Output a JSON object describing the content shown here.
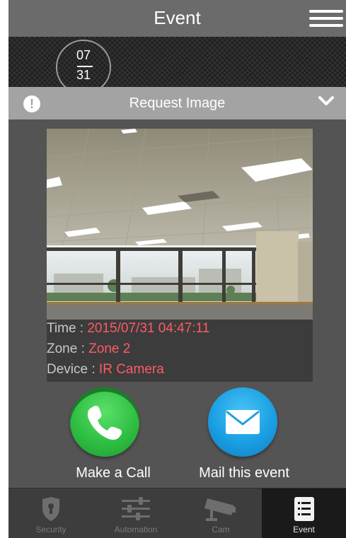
{
  "header": {
    "title": "Event"
  },
  "date_badge": {
    "month": "07",
    "day": "31"
  },
  "request_bar": {
    "label": "Request Image"
  },
  "event_info": {
    "time_label": "Time : ",
    "time_value": "2015/07/31 04:47:11",
    "zone_label": "Zone : ",
    "zone_value": "Zone 2",
    "device_label": "Device : ",
    "device_value": "IR Camera"
  },
  "actions": {
    "call_label": "Make a Call",
    "mail_label": "Mail this event"
  },
  "tabs": [
    {
      "label": "Security",
      "icon": "shield-icon",
      "active": false
    },
    {
      "label": "Automation",
      "icon": "sliders-icon",
      "active": false
    },
    {
      "label": "Cam",
      "icon": "camera-icon",
      "active": false
    },
    {
      "label": "Event",
      "icon": "list-icon",
      "active": true
    }
  ],
  "colors": {
    "highlight_value": "#ff5a64",
    "call_button": "#2fbf43",
    "mail_button": "#1a9fe3",
    "request_bar": "#a3a3a3"
  }
}
